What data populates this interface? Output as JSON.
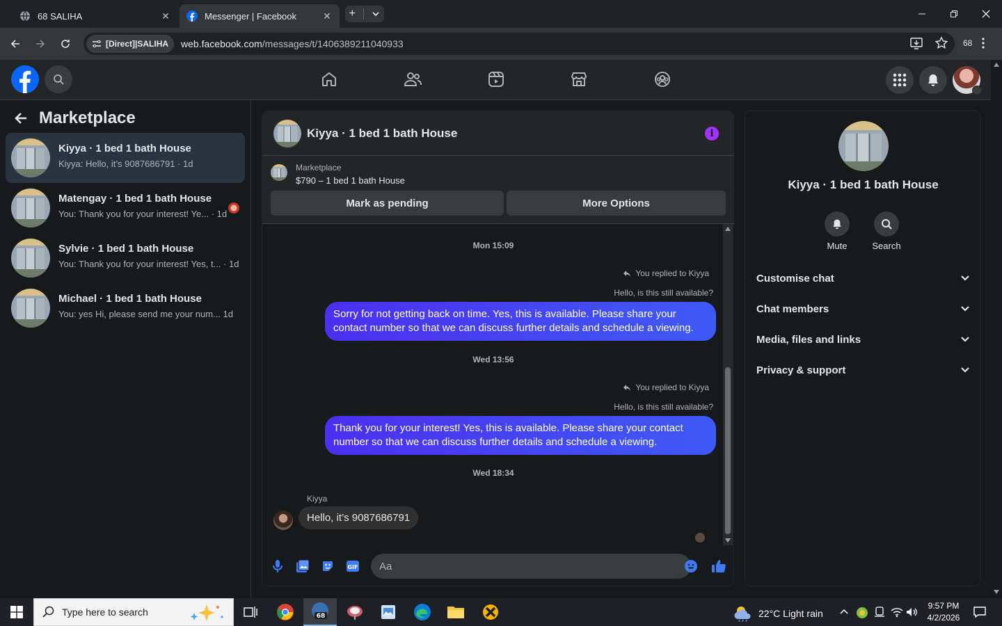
{
  "browser": {
    "tabs": [
      {
        "title": "68 SALIHA",
        "active": false
      },
      {
        "title": "Messenger | Facebook",
        "active": true
      }
    ],
    "site_chip": "[Direct]|SALIHA",
    "url_domain": "web.facebook.com",
    "url_path": "/messages/t/1406389211040933",
    "extension_badge": "68"
  },
  "left_pane": {
    "title": "Marketplace",
    "conversations": [
      {
        "name": "Kiyya · 1 bed 1 bath House",
        "preview": "Kiyya: Hello, it’s 9087686791 · 1d",
        "active": true
      },
      {
        "name": "Matengay · 1 bed 1 bath House",
        "preview": "You: Thank you for your interest! Ye... · 1d",
        "active": false
      },
      {
        "name": "Sylvie · 1 bed 1 bath House",
        "preview": "You: Thank you for your interest! Yes, t... · 1d",
        "active": false
      },
      {
        "name": "Michael · 1 bed 1 bath House",
        "preview": "You: yes Hi, please send me your num...   1d",
        "active": false
      }
    ]
  },
  "chat": {
    "title": "Kiyya · 1 bed 1 bath House",
    "marketplace_label": "Marketplace",
    "listing": "$790 – 1 bed 1 bath House",
    "btn_pending": "Mark as pending",
    "btn_more": "More Options",
    "messages": {
      "ts1": "Mon 15:09",
      "replied1": "You replied to Kiyya",
      "quote1": "Hello, is this still available?",
      "out1": "Sorry for not getting back on time. Yes, this is available. Please share your contact number so that we can discuss further details and schedule a viewing.",
      "ts2": "Wed 13:56",
      "replied2": "You replied to Kiyya",
      "quote2": "Hello, is this still available?",
      "out2": "Thank you for your interest! Yes, this is available. Please share your contact number so that we can discuss further details and schedule a viewing.",
      "ts3": "Wed 18:34",
      "sender": "Kiyya",
      "in1": "Hello, it’s 9087686791"
    },
    "composer_placeholder": "Aa"
  },
  "right_pane": {
    "name": "Kiyya · 1 bed 1 bath House",
    "mute": "Mute",
    "search": "Search",
    "sections": [
      "Customise chat",
      "Chat members",
      "Media, files and links",
      "Privacy & support"
    ]
  },
  "taskbar": {
    "search_placeholder": "Type here to search",
    "weather": "22°C  Light rain",
    "time": "9:57 PM",
    "date": "4/2/2026"
  },
  "colors": {
    "accent": "#0866ff",
    "bubble_gradient": [
      "#4c2ff0",
      "#3e5af5"
    ],
    "info": "#a033ff"
  }
}
